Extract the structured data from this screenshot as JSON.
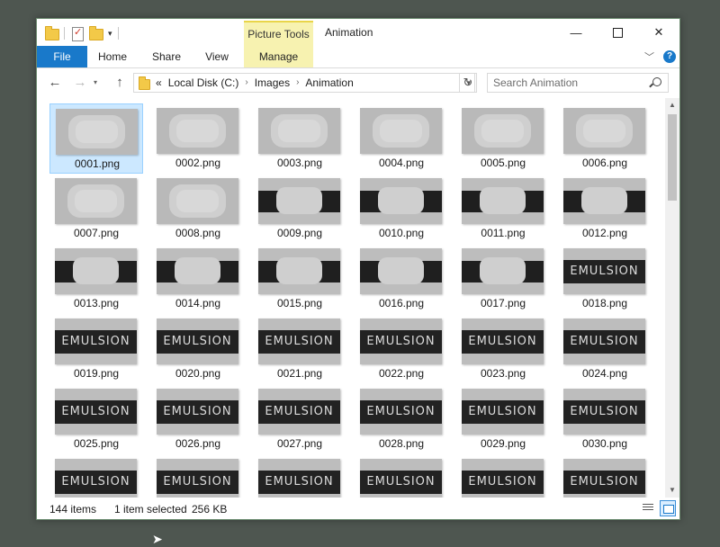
{
  "window": {
    "title": "Animation",
    "context_tab_group": "Picture Tools",
    "controls": {
      "minimize": "—",
      "close": "✕"
    }
  },
  "ribbon": {
    "tabs": [
      "File",
      "Home",
      "Share",
      "View",
      "Manage"
    ]
  },
  "navigation": {
    "back": "←",
    "forward": "→",
    "recent": "▾",
    "up": "↑",
    "refresh": "↻",
    "breadcrumb_prefix": "«",
    "breadcrumbs": [
      "Local Disk (C:)",
      "Images",
      "Animation"
    ],
    "search_placeholder": "Search Animation"
  },
  "thumbnail_text": "EMULSION",
  "files": [
    {
      "name": "0001.png",
      "kind": "light"
    },
    {
      "name": "0002.png",
      "kind": "light"
    },
    {
      "name": "0003.png",
      "kind": "light"
    },
    {
      "name": "0004.png",
      "kind": "light"
    },
    {
      "name": "0005.png",
      "kind": "light"
    },
    {
      "name": "0006.png",
      "kind": "light"
    },
    {
      "name": "0007.png",
      "kind": "light"
    },
    {
      "name": "0008.png",
      "kind": "light"
    },
    {
      "name": "0009.png",
      "kind": "mixed"
    },
    {
      "name": "0010.png",
      "kind": "mixed"
    },
    {
      "name": "0011.png",
      "kind": "mixed"
    },
    {
      "name": "0012.png",
      "kind": "mixed"
    },
    {
      "name": "0013.png",
      "kind": "mixed"
    },
    {
      "name": "0014.png",
      "kind": "mixed"
    },
    {
      "name": "0015.png",
      "kind": "mixed"
    },
    {
      "name": "0016.png",
      "kind": "mixed"
    },
    {
      "name": "0017.png",
      "kind": "mixed"
    },
    {
      "name": "0018.png",
      "kind": "dark"
    },
    {
      "name": "0019.png",
      "kind": "dark"
    },
    {
      "name": "0020.png",
      "kind": "dark"
    },
    {
      "name": "0021.png",
      "kind": "dark"
    },
    {
      "name": "0022.png",
      "kind": "dark"
    },
    {
      "name": "0023.png",
      "kind": "dark"
    },
    {
      "name": "0024.png",
      "kind": "dark"
    },
    {
      "name": "0025.png",
      "kind": "dark"
    },
    {
      "name": "0026.png",
      "kind": "dark"
    },
    {
      "name": "0027.png",
      "kind": "dark"
    },
    {
      "name": "0028.png",
      "kind": "dark"
    },
    {
      "name": "0029.png",
      "kind": "dark"
    },
    {
      "name": "0030.png",
      "kind": "dark"
    },
    {
      "name": "",
      "kind": "dark"
    },
    {
      "name": "",
      "kind": "dark"
    },
    {
      "name": "",
      "kind": "dark"
    },
    {
      "name": "",
      "kind": "dark"
    },
    {
      "name": "",
      "kind": "dark"
    },
    {
      "name": "",
      "kind": "dark"
    }
  ],
  "selected_index": 0,
  "status": {
    "item_count": "144 items",
    "selection": "1 item selected",
    "size": "256 KB"
  },
  "colors": {
    "accent": "#1979ca",
    "context_tab": "#f7f2b0",
    "selection": "#cce8ff"
  }
}
